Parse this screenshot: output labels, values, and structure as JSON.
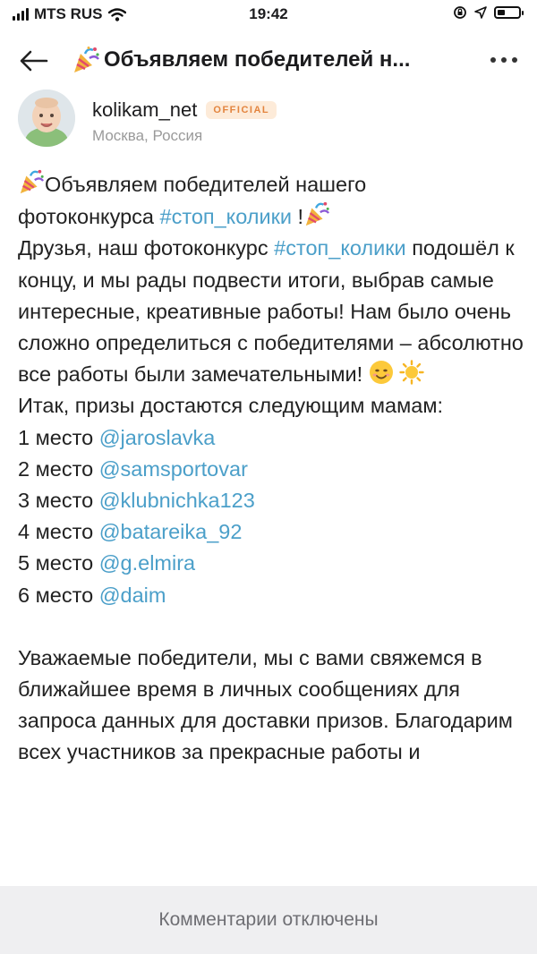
{
  "status_bar": {
    "carrier": "MTS RUS",
    "time": "19:42",
    "battery_level": 0.35
  },
  "header": {
    "title": "Объявляем победителей н..."
  },
  "author": {
    "name": "kolikam_net",
    "badge": "OFFICIAL",
    "location": "Москва, Россия"
  },
  "post": {
    "line1_prefix": "Объявляем победителей нашего",
    "line2_prefix": "фотоконкурса ",
    "tag": "#стоп_колики",
    "line2_suffix": " !",
    "para1_prefix": "Друзья, наш фотоконкурс ",
    "para1_rest": " подошёл к концу, и мы рады подвести итоги, выбрав самые интересные, креативные работы! Нам было очень сложно определиться с победителями – абсолютно все работы были замечательными! ",
    "para2": "Итак, призы достаются следующим мамам:",
    "places": [
      {
        "label": "1 место ",
        "user": "@jaroslavka"
      },
      {
        "label": "2 место ",
        "user": "@samsportovar"
      },
      {
        "label": "3 место ",
        "user": "@klubnichka123"
      },
      {
        "label": "4 место ",
        "user": "@batareika_92"
      },
      {
        "label": "5 место ",
        "user": "@g.elmira"
      },
      {
        "label": "6 место ",
        "user": "@daim"
      }
    ],
    "para3": "Уважаемые победители, мы с вами свяжемся в ближайшее время в личных сообщениях для запроса данных для доставки призов. Благодарим всех участников за прекрасные работы и"
  },
  "footer": {
    "comments_disabled": "Комментарии отключены"
  }
}
